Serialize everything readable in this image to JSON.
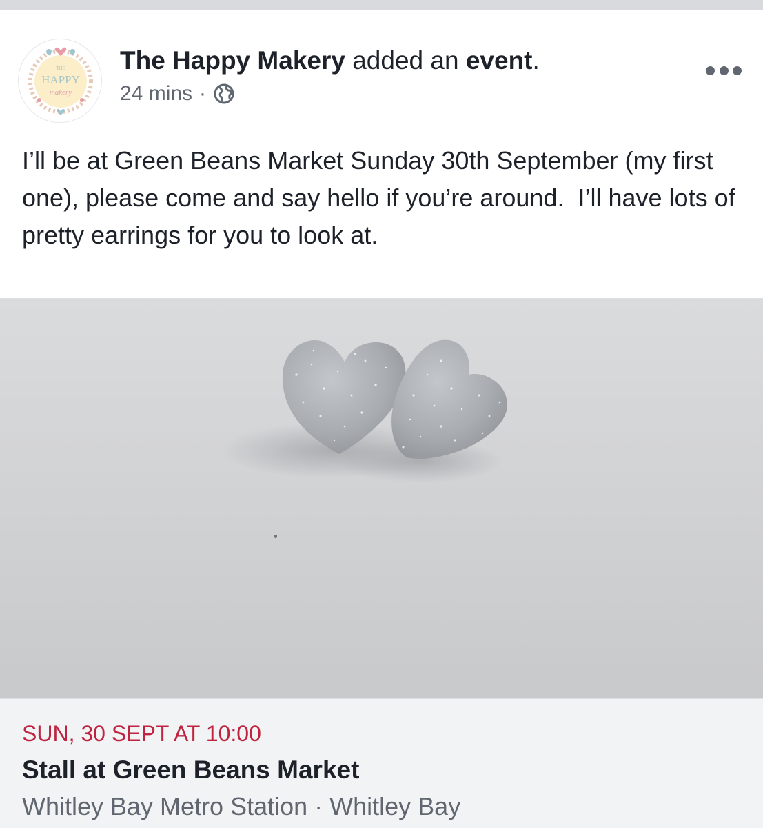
{
  "post": {
    "author": "The Happy Makery",
    "action_text": "added an",
    "action_object": "event",
    "period": ".",
    "timestamp": "24 mins",
    "separator": "·",
    "privacy_icon": "globe-icon",
    "more_icon": "ellipsis-icon",
    "body": "I’ll be at Green Beans Market Sunday 30th September (my first one), please come and say hello if you’re around.  I’ll have lots of pretty earrings for you to look at."
  },
  "avatar": {
    "logo_top": "THE",
    "logo_main": "HAPPY",
    "logo_sub": "makery"
  },
  "event": {
    "date": "SUN, 30 SEPT AT 10:00",
    "title": "Stall at Green Beans Market",
    "location": "Whitley Bay Metro Station · Whitley Bay"
  },
  "colors": {
    "date_red": "#be2340",
    "meta_gray": "#616770",
    "text_dark": "#1d2129",
    "card_bg": "#f2f3f5"
  }
}
